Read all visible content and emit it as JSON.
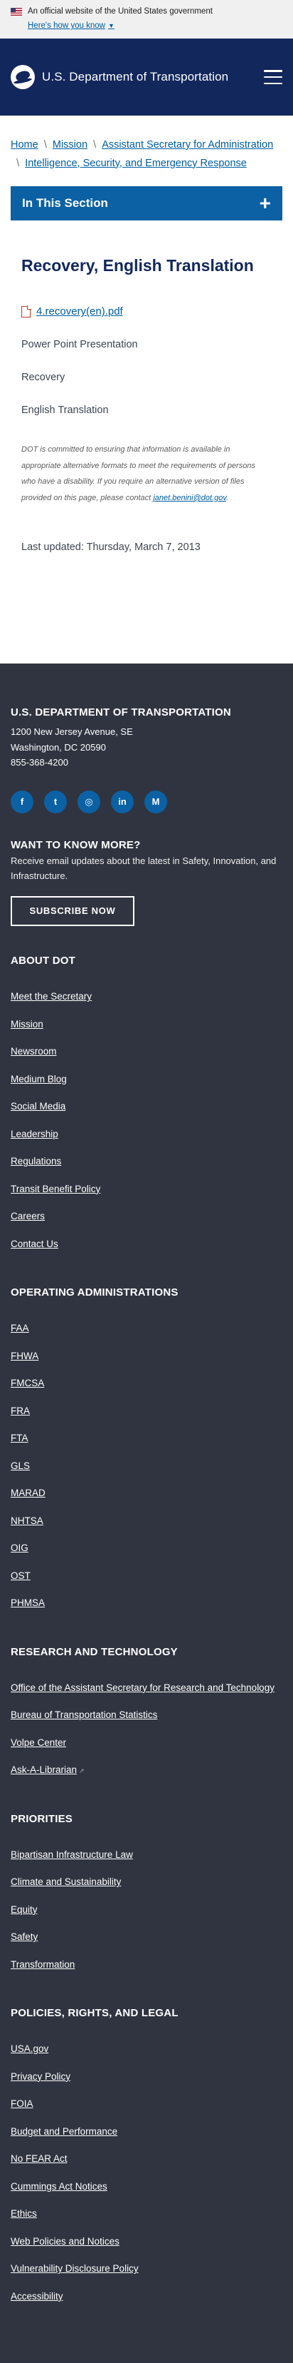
{
  "gov_banner": {
    "official_text": "An official website of the United States government",
    "how_know": "Here's how you know"
  },
  "header": {
    "title": "U.S. Department of Transportation"
  },
  "breadcrumb": [
    "Home",
    "Mission",
    "Assistant Secretary for Administration",
    "Intelligence, Security, and Emergency Response"
  ],
  "section_nav": {
    "label": "In This Section"
  },
  "page": {
    "title": "Recovery, English Translation",
    "file_name": "4.recovery(en).pdf",
    "type_label": "Power Point Presentation",
    "category": "Recovery",
    "language": "English Translation",
    "disclaimer_text": "DOT is committed to ensuring that information is available in appropriate alternative formats to meet the requirements of persons who have a disability. If you require an alternative version of files provided on this page, please contact",
    "disclaimer_email": "janet.benini@dot.gov",
    "disclaimer_end": ".",
    "last_updated": "Last updated: Thursday, March 7, 2013"
  },
  "footer": {
    "org_name": "U.S. DEPARTMENT OF TRANSPORTATION",
    "address_1": "1200 New Jersey Avenue, SE",
    "address_2": "Washington, DC 20590",
    "phone": "855-368-4200",
    "socials": [
      {
        "icon": "facebook-icon",
        "glyph": "f"
      },
      {
        "icon": "twitter-icon",
        "glyph": "t"
      },
      {
        "icon": "instagram-icon",
        "glyph": "◎"
      },
      {
        "icon": "linkedin-icon",
        "glyph": "in"
      },
      {
        "icon": "medium-icon",
        "glyph": "M"
      }
    ],
    "want_title": "WANT TO KNOW MORE?",
    "want_text": "Receive email updates about the latest in Safety, Innovation, and Infrastructure.",
    "subscribe_label": "SUBSCRIBE NOW",
    "about_title": "ABOUT DOT",
    "about_links": [
      "Meet the Secretary",
      "Mission",
      "Newsroom",
      "Medium Blog",
      "Social Media",
      "Leadership",
      "Regulations",
      "Transit Benefit Policy",
      "Careers",
      "Contact Us"
    ],
    "ops_title": "OPERATING ADMINISTRATIONS",
    "ops_links": [
      "FAA",
      "FHWA",
      "FMCSA",
      "FRA",
      "FTA",
      "GLS",
      "MARAD",
      "NHTSA",
      "OIG",
      "OST",
      "PHMSA"
    ],
    "research_title": "RESEARCH AND TECHNOLOGY",
    "research_links": [
      "Office of the Assistant Secretary for Research and Technology",
      "Bureau of Transportation Statistics",
      "Volpe Center",
      "Ask-A-Librarian"
    ],
    "priorities_title": "PRIORITIES",
    "priorities_links": [
      "Bipartisan Infrastructure Law",
      "Climate and Sustainability",
      "Equity",
      "Safety",
      "Transformation"
    ],
    "policies_title": "POLICIES, RIGHTS, AND LEGAL",
    "policies_links": [
      "USA.gov",
      "Privacy Policy",
      "FOIA",
      "Budget and Performance",
      "No FEAR Act",
      "Cummings Act Notices",
      "Ethics",
      "Web Policies and Notices",
      "Vulnerability Disclosure Policy",
      "Accessibility"
    ]
  },
  "colors": {
    "header_bg": "#12275c",
    "accent_blue": "#0b61a4",
    "link": "#005ea2",
    "footer_bg": "#2f3440"
  }
}
